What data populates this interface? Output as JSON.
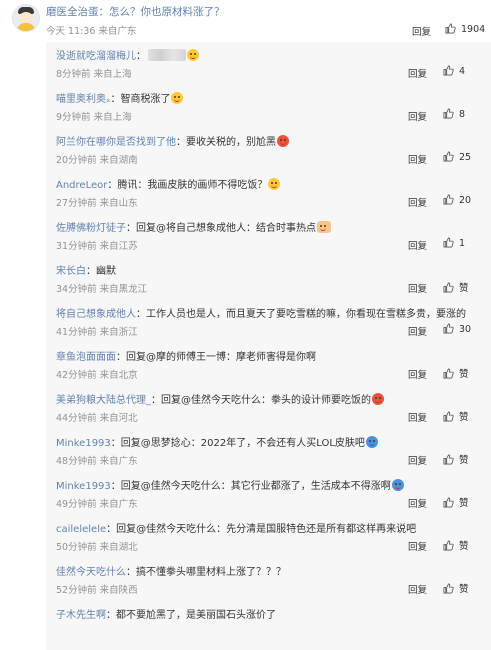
{
  "top_comment": {
    "text": "磨医全治蛋：怎么？你也原材料涨了？",
    "meta": "今天 11:36 来自广东",
    "reply": "回复",
    "likes": "1904"
  },
  "replies": [
    {
      "nick": "没逝就吃溜溜梅儿",
      "text": "：",
      "time": "8分钟前",
      "loc": "来自上海",
      "reply": "回复",
      "likes": "4",
      "emoji": "face",
      "blurred": true
    },
    {
      "nick": "喵里奥利奥ₓ",
      "text": "：智商税涨了",
      "time": "9分钟前",
      "loc": "来自上海",
      "reply": "回复",
      "likes": "8",
      "emoji": "face"
    },
    {
      "nick": "阿兰你在哪你是否找到了他",
      "text": "：要收关税的，别尬黑",
      "time": "20分钟前",
      "loc": "来自湖南",
      "reply": "回复",
      "likes": "25",
      "emoji": "red"
    },
    {
      "nick": "AndreLeor",
      "text": "：腾讯：我画皮肤的画师不得吃饭？",
      "time": "27分钟前",
      "loc": "来自山东",
      "reply": "回复",
      "likes": "20",
      "emoji": "face"
    },
    {
      "nick": "佐膊佛粉灯徒子",
      "text": "：回复@将自己想象成他人：结合时事热点",
      "time": "31分钟前",
      "loc": "来自江苏",
      "reply": "回复",
      "likes": "1",
      "emoji": "hand"
    },
    {
      "nick": "宋长白",
      "text": "：幽默",
      "time": "34分钟前",
      "loc": "来自黑龙江",
      "reply": "回复",
      "likes": "赞"
    },
    {
      "nick": "将自己想象成他人",
      "text": "：工作人员也是人，而且夏天了要吃雪糕的嘛，你看现在雪糕多贵，要涨的",
      "time": "41分钟前",
      "loc": "来自浙江",
      "reply": "回复",
      "likes": "30"
    },
    {
      "nick": "章鱼泡面面面",
      "text": "：回复@摩的师傅王一博：摩老师害得是你啊",
      "time": "42分钟前",
      "loc": "来自北京",
      "reply": "回复",
      "likes": "赞"
    },
    {
      "nick": "美弟狗粮大陆总代理_",
      "text": "：回复@佳然今天吃什么：拳头的设计师要吃饭的",
      "time": "44分钟前",
      "loc": "来自河北",
      "reply": "回复",
      "likes": "赞",
      "emoji": "red"
    },
    {
      "nick": "Minke1993",
      "text": "：回复@思梦捻心：2022年了，不会还有人买LOL皮肤吧",
      "time": "48分钟前",
      "loc": "来自广东",
      "reply": "回复",
      "likes": "赞",
      "emoji": "blue"
    },
    {
      "nick": "Minke1993",
      "text": "：回复@佳然今天吃什么：其它行业都涨了，生活成本不得涨啊",
      "time": "49分钟前",
      "loc": "来自广东",
      "reply": "回复",
      "likes": "赞",
      "emoji": "blue"
    },
    {
      "nick": "cailelelele",
      "text": "：回复@佳然今天吃什么：先分清是国服特色还是所有都这样再来说吧",
      "time": "50分钟前",
      "loc": "来自湖北",
      "reply": "回复",
      "likes": "赞"
    },
    {
      "nick": "佳然今天吃什么",
      "text": "：搞不懂拳头哪里材料上涨了？？？",
      "time": "52分钟前",
      "loc": "来自陕西",
      "reply": "回复",
      "likes": "赞"
    },
    {
      "nick": "子木先生啊",
      "text": "：都不要尬黑了，是美丽国石头涨价了",
      "time": "",
      "loc": "",
      "reply": "",
      "likes": ""
    }
  ],
  "icons": {
    "thumb": "thumbs-up-icon",
    "avatar": "avatar"
  },
  "colors": {
    "nick": "#6183b0",
    "meta": "#939393",
    "panel": "#f7f7f7"
  }
}
